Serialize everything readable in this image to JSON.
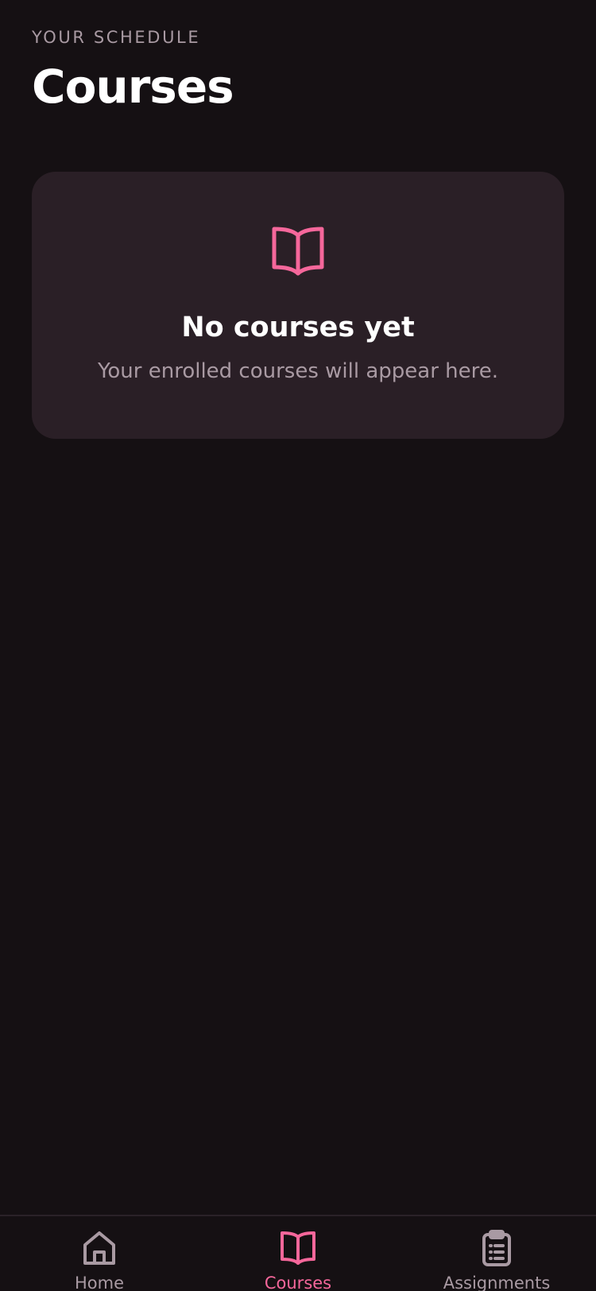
{
  "header": {
    "eyebrow": "YOUR SCHEDULE",
    "title": "Courses"
  },
  "empty_state": {
    "icon": "book-open-icon",
    "title": "No courses yet",
    "subtitle": "Your enrolled courses will appear here."
  },
  "tab_bar": {
    "tabs": [
      {
        "label": "Home",
        "icon": "home-icon",
        "active": false
      },
      {
        "label": "Courses",
        "icon": "book-open-icon",
        "active": true
      },
      {
        "label": "Assignments",
        "icon": "clipboard-list-icon",
        "active": false
      }
    ]
  },
  "colors": {
    "background": "#151013",
    "card": "#2a1f26",
    "accent": "#f5679b",
    "muted_text": "#a99aa3",
    "primary_text": "#ffffff"
  }
}
